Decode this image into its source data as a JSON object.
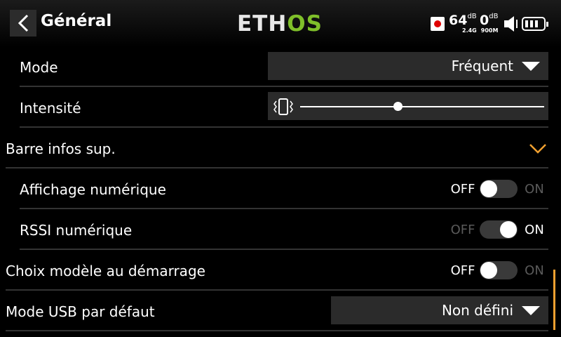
{
  "header": {
    "title": "Général",
    "logo_a": "ETH",
    "logo_b": "OS",
    "rssi1": "64",
    "rssi1_unit": "dB",
    "rssi2": "0",
    "rssi2_unit": "dB",
    "band1": "2.4G",
    "band2": "900M"
  },
  "rows": {
    "mode": {
      "label": "Mode",
      "value": "Fréquent"
    },
    "intensite": {
      "label": "Intensité",
      "level": 0.4
    },
    "barre": {
      "label": "Barre infos sup."
    },
    "affichage": {
      "label": "Affichage numérique",
      "off": "OFF",
      "on": "ON",
      "state": "off"
    },
    "rssi": {
      "label": "RSSI numérique",
      "off": "OFF",
      "on": "ON",
      "state": "on"
    },
    "choix": {
      "label": "Choix modèle au démarrage",
      "off": "OFF",
      "on": "ON",
      "state": "off"
    },
    "usb": {
      "label": "Mode USB par défaut",
      "value": "Non défini"
    }
  },
  "colors": {
    "accent": "#f0a030",
    "logo_green": "#7fbf2a"
  }
}
